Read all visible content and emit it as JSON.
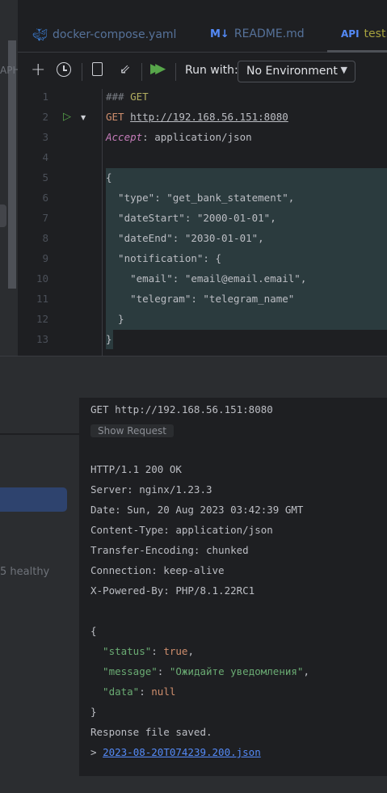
{
  "left_panel": {
    "partial_label": "APH",
    "health_text": "5 healthy"
  },
  "tabs": [
    {
      "icon": "docker-icon",
      "label": "docker-compose.yaml"
    },
    {
      "icon": "markdown-icon",
      "icon_text": "M↓",
      "label": "README.md"
    },
    {
      "icon": "api-icon",
      "icon_text": "API",
      "label": "test.h",
      "active": true
    }
  ],
  "toolbar": {
    "run_with_label": "Run with:",
    "environment": "No Environment"
  },
  "editor": {
    "lines": [
      [
        {
          "t": "### ",
          "c": "#7a7e85"
        },
        {
          "t": "GET",
          "c": "#b3ae60"
        }
      ],
      [
        {
          "t": "GET ",
          "c": "#cf8e6d"
        },
        {
          "t": "http://192.168.56.151:8080",
          "c": "#bcbec4",
          "u": true
        }
      ],
      [
        {
          "t": "Accept",
          "c": "#c77dbb",
          "i": true
        },
        {
          "t": ": application/json",
          "c": "#bcbec4"
        }
      ],
      [],
      [
        {
          "t": "{",
          "c": "#bcbec4"
        }
      ],
      [
        {
          "t": "  \"type\": \"get_bank_statement\",",
          "c": "#bcbec4"
        }
      ],
      [
        {
          "t": "  \"dateStart\": \"2000-01-01\",",
          "c": "#bcbec4"
        }
      ],
      [
        {
          "t": "  \"dateEnd\": \"2030-01-01\",",
          "c": "#bcbec4"
        }
      ],
      [
        {
          "t": "  \"notification\": {",
          "c": "#bcbec4"
        }
      ],
      [
        {
          "t": "    \"email\": \"email@email.email\",",
          "c": "#bcbec4"
        }
      ],
      [
        {
          "t": "    \"telegram\": \"telegram_name\"",
          "c": "#bcbec4"
        }
      ],
      [
        {
          "t": "  }",
          "c": "#bcbec4"
        }
      ],
      [
        {
          "t": "}",
          "c": "#bcbec4"
        }
      ]
    ]
  },
  "response": {
    "request_line": "GET http://192.168.56.151:8080",
    "show_request_label": "Show Request",
    "lines": [
      [
        {
          "t": "HTTP/1.1 200 OK",
          "c": "#bcbec4"
        }
      ],
      [
        {
          "t": "Server: nginx/1.23.3",
          "c": "#bcbec4"
        }
      ],
      [
        {
          "t": "Date: Sun, 20 Aug 2023 03:42:39 GMT",
          "c": "#bcbec4"
        }
      ],
      [
        {
          "t": "Content-Type: application/json",
          "c": "#bcbec4"
        }
      ],
      [
        {
          "t": "Transfer-Encoding: chunked",
          "c": "#bcbec4"
        }
      ],
      [
        {
          "t": "Connection: keep-alive",
          "c": "#bcbec4"
        }
      ],
      [
        {
          "t": "X-Powered-By: PHP/8.1.22RC1",
          "c": "#bcbec4"
        }
      ],
      [],
      [
        {
          "t": "{",
          "c": "#bcbec4"
        }
      ],
      [
        {
          "t": "  \"status\"",
          "c": "#6aab73"
        },
        {
          "t": ": ",
          "c": "#bcbec4"
        },
        {
          "t": "true",
          "c": "#cf8e6d"
        },
        {
          "t": ",",
          "c": "#bcbec4"
        }
      ],
      [
        {
          "t": "  \"message\"",
          "c": "#6aab73"
        },
        {
          "t": ": ",
          "c": "#bcbec4"
        },
        {
          "t": "\"Ожидайте уведомления\"",
          "c": "#6aab73"
        },
        {
          "t": ",",
          "c": "#bcbec4"
        }
      ],
      [
        {
          "t": "  \"data\"",
          "c": "#6aab73"
        },
        {
          "t": ": ",
          "c": "#bcbec4"
        },
        {
          "t": "null",
          "c": "#cf8e6d"
        }
      ],
      [
        {
          "t": "}",
          "c": "#bcbec4"
        }
      ],
      [
        {
          "t": "Response file saved.",
          "c": "#bcbec4"
        }
      ],
      [
        {
          "t": "> ",
          "c": "#bcbec4"
        },
        {
          "t": "2023-08-20T074239.200.json",
          "c": "#548af7",
          "link": true
        }
      ]
    ]
  }
}
